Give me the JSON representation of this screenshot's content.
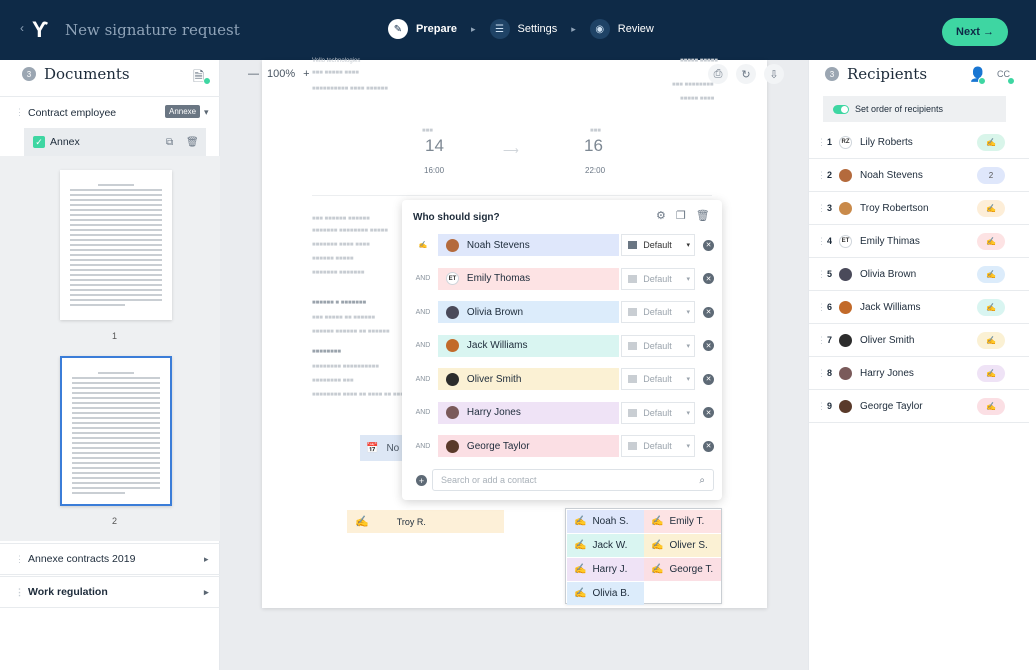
{
  "header": {
    "back_icon": "‹",
    "logo": "Ƴ",
    "title": "New signature request",
    "steps": [
      {
        "label": "Prepare",
        "icon": "prepare-icon",
        "glyph": "✎"
      },
      {
        "label": "Settings",
        "icon": "settings-icon",
        "glyph": "☰"
      },
      {
        "label": "Review",
        "icon": "review-icon",
        "glyph": "◉"
      }
    ],
    "next_label": "Next →"
  },
  "documents": {
    "title": "Documents",
    "badge": "3",
    "items": [
      {
        "label": "Contract employee",
        "tag": "Annexe",
        "expanded": true
      },
      {
        "label": "Annexe contracts 2019",
        "expanded": false
      },
      {
        "label": "Work regulation",
        "expanded": false
      }
    ],
    "annex_label": "Annex",
    "pages": [
      "1",
      "2"
    ]
  },
  "viewer": {
    "zoom": "100%",
    "date_from": {
      "day": "14",
      "time": "16:00"
    },
    "date_to": {
      "day": "16",
      "time": "22:00"
    },
    "date_field_label": "No",
    "signature_box_label": "Troy R."
  },
  "modal": {
    "title": "Who should sign?",
    "rows": [
      {
        "type": "sign",
        "name": "Noah Stevens",
        "color": "#dfe7fb",
        "avatar": "",
        "avatar_color": "#b46a3c",
        "option": "Default"
      },
      {
        "type": "AND",
        "name": "Emily Thomas",
        "color": "#fde3e4",
        "avatar": "ET",
        "avatar_color": "",
        "option": "Default"
      },
      {
        "type": "AND",
        "name": "Olivia Brown",
        "color": "#dcecfb",
        "avatar": "",
        "avatar_color": "#4a4a5a",
        "option": "Default"
      },
      {
        "type": "AND",
        "name": "Jack Williams",
        "color": "#d9f5f1",
        "avatar": "",
        "avatar_color": "#c26a2a",
        "option": "Default"
      },
      {
        "type": "AND",
        "name": "Oliver Smith",
        "color": "#fbf1d4",
        "avatar": "",
        "avatar_color": "#2c2c2c",
        "option": "Default"
      },
      {
        "type": "AND",
        "name": "Harry Jones",
        "color": "#efe3f6",
        "avatar": "",
        "avatar_color": "#7a5a5a",
        "option": "Default"
      },
      {
        "type": "AND",
        "name": "George Taylor",
        "color": "#fbdfe4",
        "avatar": "",
        "avatar_color": "#5a3a2a",
        "option": "Default"
      }
    ],
    "search_placeholder": "Search or add a contact"
  },
  "signature_pad": {
    "cells": [
      {
        "label": "Noah S.",
        "color": "#dfe7fb"
      },
      {
        "label": "Emily T.",
        "color": "#fde3e4"
      },
      {
        "label": "Jack W.",
        "color": "#d9f5f1"
      },
      {
        "label": "Oliver S.",
        "color": "#fbf1d4"
      },
      {
        "label": "Harry J.",
        "color": "#efe3f6"
      },
      {
        "label": "George T.",
        "color": "#fbdfe4"
      },
      {
        "label": "Olivia B.",
        "color": "#dcecfb"
      }
    ]
  },
  "recipients": {
    "title": "Recipients",
    "badge": "3",
    "cc_label": "CC",
    "order_toggle": "Set order of recipients",
    "list": [
      {
        "n": "1",
        "name": "Lily Roberts",
        "initials": "RZ",
        "avatar_color": "",
        "pill": "✍",
        "pill_color": "#d9f5ea"
      },
      {
        "n": "2",
        "name": "Noah Stevens",
        "initials": "",
        "avatar_color": "#b46a3c",
        "pill": "2",
        "pill_color": "#dfe7fb"
      },
      {
        "n": "3",
        "name": "Troy Robertson",
        "initials": "",
        "avatar_color": "#c98a4a",
        "pill": "✍",
        "pill_color": "#fdeed8"
      },
      {
        "n": "4",
        "name": "Emily Thimas",
        "initials": "ET",
        "avatar_color": "",
        "pill": "✍",
        "pill_color": "#fde3e4"
      },
      {
        "n": "5",
        "name": "Olivia Brown",
        "initials": "",
        "avatar_color": "#4a4a5a",
        "pill": "✍",
        "pill_color": "#dcecfb"
      },
      {
        "n": "6",
        "name": "Jack Williams",
        "initials": "",
        "avatar_color": "#c26a2a",
        "pill": "✍",
        "pill_color": "#d9f5f1"
      },
      {
        "n": "7",
        "name": "Oliver Smith",
        "initials": "",
        "avatar_color": "#2c2c2c",
        "pill": "✍",
        "pill_color": "#fbf1d4"
      },
      {
        "n": "8",
        "name": "Harry Jones",
        "initials": "",
        "avatar_color": "#7a5a5a",
        "pill": "✍",
        "pill_color": "#efe3f6"
      },
      {
        "n": "9",
        "name": "George Taylor",
        "initials": "",
        "avatar_color": "#5a3a2a",
        "pill": "✍",
        "pill_color": "#fbdfe4"
      }
    ]
  }
}
